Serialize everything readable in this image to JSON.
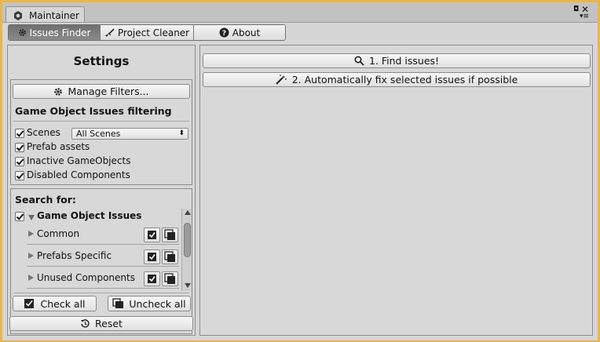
{
  "window": {
    "title": "Maintainer"
  },
  "toolbar": {
    "tabs": [
      {
        "label": "Issues Finder"
      },
      {
        "label": "Project Cleaner"
      },
      {
        "label": "About"
      }
    ]
  },
  "settings": {
    "title": "Settings",
    "manage_filters": "Manage Filters...",
    "filter_heading": "Game Object Issues filtering",
    "options": [
      {
        "label": "Scenes",
        "checked": true
      },
      {
        "label": "Prefab assets",
        "checked": true
      },
      {
        "label": "Inactive GameObjects",
        "checked": true
      },
      {
        "label": "Disabled Components",
        "checked": true
      }
    ],
    "scenes_dropdown": "All Scenes"
  },
  "search": {
    "heading": "Search for:",
    "group": {
      "label": "Game Object Issues",
      "checked": true
    },
    "items": [
      {
        "label": "Common"
      },
      {
        "label": "Prefabs Specific"
      },
      {
        "label": "Unused Components"
      }
    ],
    "check_all": "Check all",
    "uncheck_all": "Uncheck all"
  },
  "reset": "Reset",
  "actions": {
    "find": "1. Find issues!",
    "fix": "2. Automatically fix selected issues if possible"
  }
}
